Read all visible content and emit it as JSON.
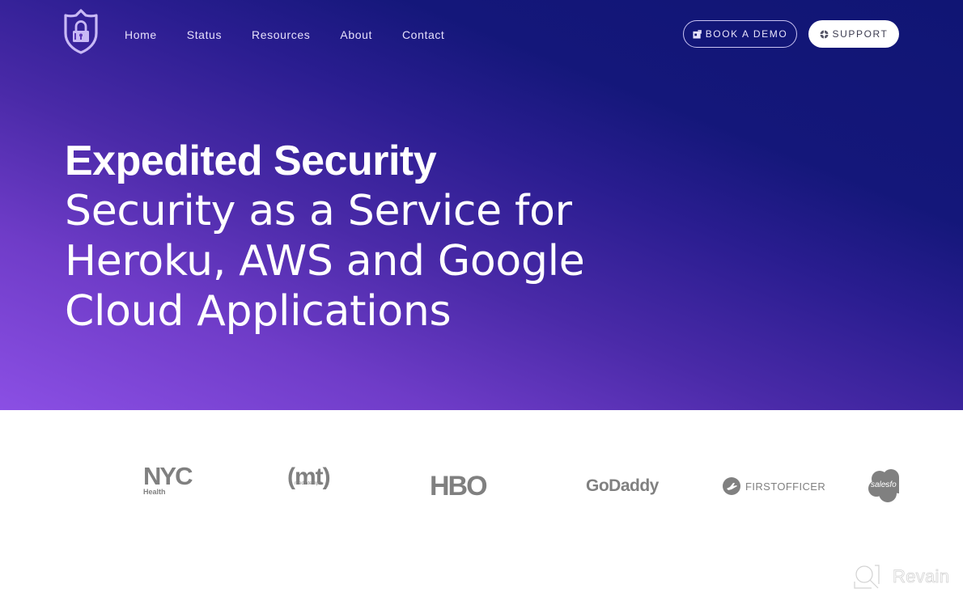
{
  "brand": {
    "logo_icon": "shield-lock-icon",
    "colors": {
      "gradient_start": "#8b4fe4",
      "gradient_end": "#101574",
      "nav_text": "#e6e0fb",
      "logo_gray": "#808080"
    }
  },
  "nav": {
    "links": [
      {
        "label": "Home"
      },
      {
        "label": "Status"
      },
      {
        "label": "Resources"
      },
      {
        "label": "About"
      },
      {
        "label": "Contact"
      }
    ],
    "book_demo": {
      "label": "BOOK A DEMO",
      "icon": "calendar-share-icon"
    },
    "support": {
      "label": "SUPPORT",
      "icon": "lifebuoy-icon"
    }
  },
  "hero": {
    "title": "Expedited Security",
    "subtitle_lines": [
      "Security as a Service for",
      "Heroku, AWS and Google",
      "Cloud Applications"
    ]
  },
  "customers": {
    "logos": [
      {
        "name": "NYC",
        "sub": "Health"
      },
      {
        "name": "(mt)",
        "sub": "mediatemple"
      },
      {
        "name": "HBO"
      },
      {
        "name": "GoDaddy"
      },
      {
        "name": "FirstOfficer",
        "display": "FIRSTOFFICER"
      },
      {
        "name": "salesforce",
        "display": "salesfo"
      }
    ]
  },
  "watermark": {
    "text": "Revain"
  }
}
